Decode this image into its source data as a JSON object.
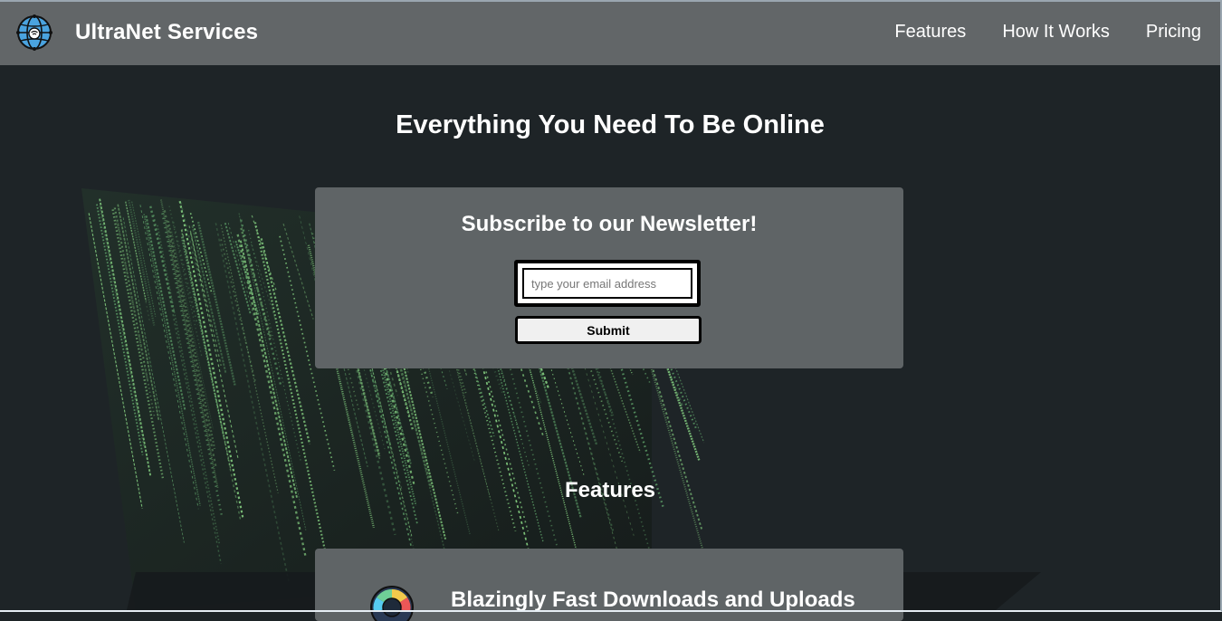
{
  "header": {
    "brand": "UltraNet Services",
    "nav": [
      "Features",
      "How It Works",
      "Pricing"
    ],
    "logo_icon": "globe-wifi-icon"
  },
  "hero": {
    "title": "Everything You Need To Be Online"
  },
  "newsletter": {
    "heading": "Subscribe to our Newsletter!",
    "email_placeholder": "type your email address",
    "submit_label": "Submit"
  },
  "features": {
    "heading": "Features",
    "items": [
      {
        "title": "Blazingly Fast Downloads and Uploads",
        "icon": "speedometer-icon"
      }
    ]
  },
  "colors": {
    "navbar": "#626668",
    "background": "#1e2427",
    "card": "#5f6466",
    "matrix_green": "#7fd07a",
    "logo_blue": "#4aa3df"
  }
}
